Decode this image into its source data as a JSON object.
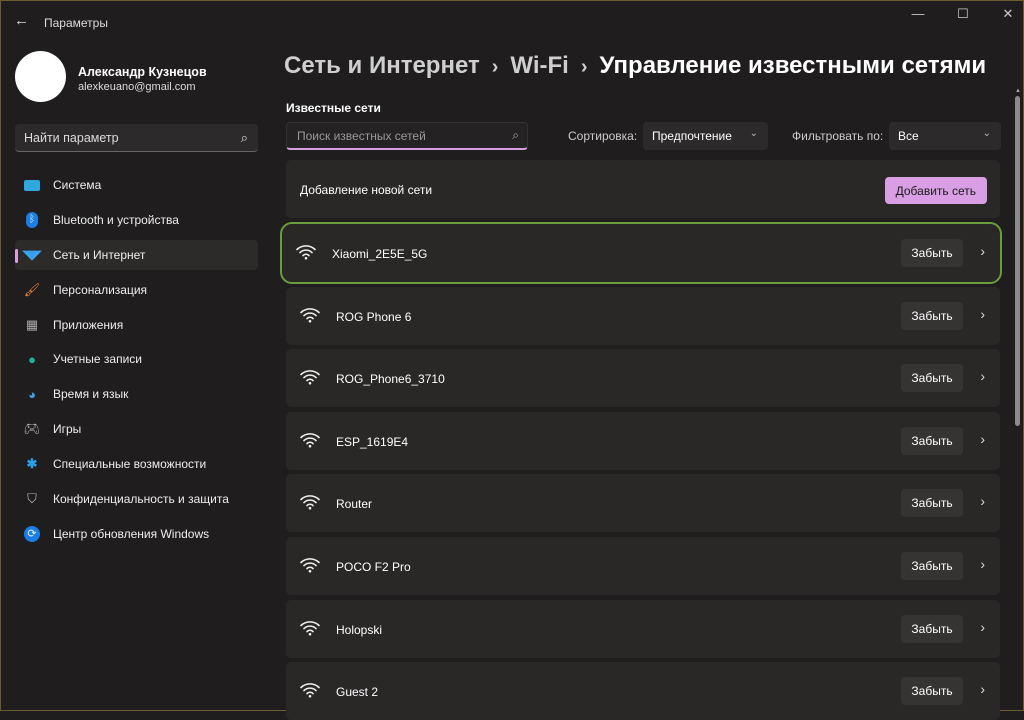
{
  "window": {
    "title": "Параметры",
    "minimize": "—",
    "maximize": "☐",
    "close": "✕"
  },
  "user": {
    "name": "Александр Кузнецов",
    "email": "alexkeuano@gmail.com"
  },
  "sidebar": {
    "search_placeholder": "Найти параметр",
    "items": [
      {
        "label": "Система",
        "icon": "monitor-icon"
      },
      {
        "label": "Bluetooth и устройства",
        "icon": "bluetooth-icon"
      },
      {
        "label": "Сеть и Интернет",
        "icon": "wifi-icon",
        "active": true
      },
      {
        "label": "Персонализация",
        "icon": "brush-icon"
      },
      {
        "label": "Приложения",
        "icon": "apps-icon"
      },
      {
        "label": "Учетные записи",
        "icon": "person-icon"
      },
      {
        "label": "Время и язык",
        "icon": "globe-clock-icon"
      },
      {
        "label": "Игры",
        "icon": "gamepad-icon"
      },
      {
        "label": "Специальные возможности",
        "icon": "accessibility-icon"
      },
      {
        "label": "Конфиденциальность и защита",
        "icon": "shield-icon"
      },
      {
        "label": "Центр обновления Windows",
        "icon": "update-icon"
      }
    ]
  },
  "breadcrumb": [
    "Сеть и Интернет",
    "Wi-Fi",
    "Управление известными сетями"
  ],
  "known": {
    "title": "Известные сети",
    "search_placeholder": "Поиск известных сетей",
    "sort_label": "Сортировка:",
    "sort_value": "Предпочтение",
    "filter_label": "Фильтровать по:",
    "filter_value": "Все",
    "add_text": "Добавление новой сети",
    "add_button": "Добавить сеть",
    "forget_label": "Забыть",
    "networks": [
      "Xiaomi_2E5E_5G",
      "ROG Phone 6",
      "ROG_Phone6_3710",
      "ESP_1619E4",
      "Router",
      "POCO F2 Pro",
      "Holopski",
      "Guest 2"
    ]
  },
  "colors": {
    "accent": "#d99ee3",
    "highlight": "#6a9e3a"
  }
}
